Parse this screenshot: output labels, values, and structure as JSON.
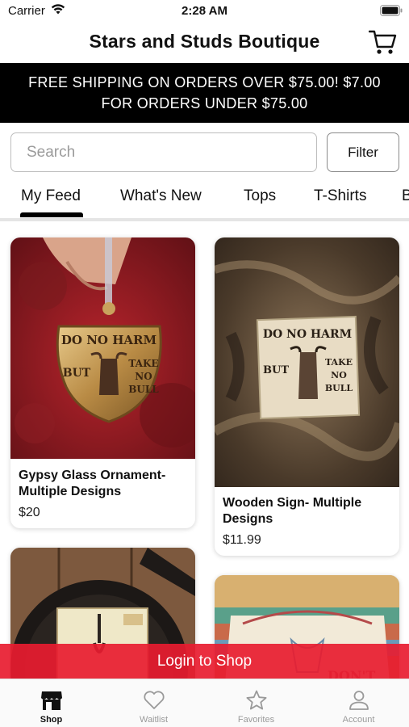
{
  "status_bar": {
    "carrier": "Carrier",
    "time": "2:28 AM"
  },
  "header": {
    "title": "Stars and Studs Boutique"
  },
  "banner": {
    "line1": "FREE SHIPPING ON ORDERS OVER $75.00! $7.00",
    "line2": "FOR ORDERS UNDER $75.00"
  },
  "search": {
    "placeholder": "Search",
    "filter_label": "Filter"
  },
  "category_tabs": [
    {
      "label": "My Feed",
      "active": true
    },
    {
      "label": "What's New"
    },
    {
      "label": "Tops"
    },
    {
      "label": "T-Shirts"
    },
    {
      "label": "B"
    }
  ],
  "products": [
    {
      "name": "Gypsy Glass Ornament- Multiple Designs",
      "price": "$20"
    },
    {
      "name": "Wooden Sign- Multiple Designs",
      "price": "$11.99"
    }
  ],
  "login_cta": "Login to Shop",
  "bottom_tabs": [
    {
      "label": "Shop",
      "icon": "shop-icon",
      "active": true
    },
    {
      "label": "Waitlist",
      "icon": "heart-icon"
    },
    {
      "label": "Favorites",
      "icon": "star-icon"
    },
    {
      "label": "Account",
      "icon": "person-icon"
    }
  ],
  "colors": {
    "banner_bg": "#000000",
    "login_bar": "#e81c30",
    "accent": "#000000"
  }
}
